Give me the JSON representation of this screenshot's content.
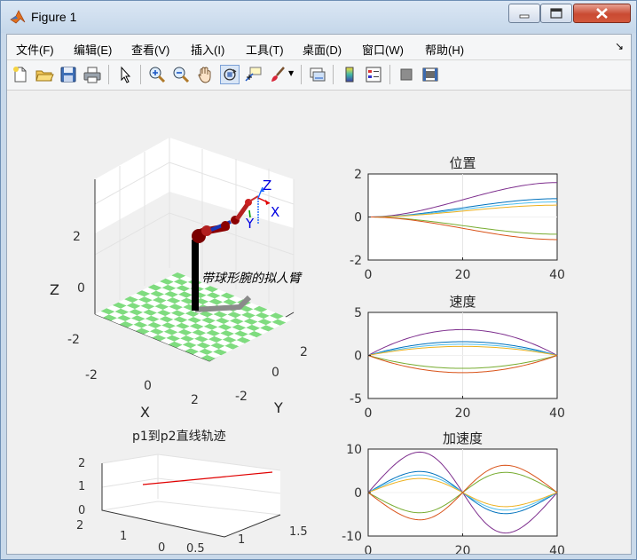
{
  "window": {
    "title": "Figure 1",
    "icon": "matlab-icon"
  },
  "menubar": {
    "items": [
      "文件(F)",
      "编辑(E)",
      "查看(V)",
      "插入(I)",
      "工具(T)",
      "桌面(D)",
      "窗口(W)",
      "帮助(H)"
    ],
    "overflow_arrow": "↘"
  },
  "toolbar": {
    "icons": [
      "new-figure-icon",
      "open-file-icon",
      "save-icon",
      "print-icon",
      "select-pointer-icon",
      "zoom-in-icon",
      "zoom-out-icon",
      "pan-hand-icon",
      "rotate-3d-icon",
      "data-cursor-icon",
      "brush-icon",
      "link-plot-icon",
      "colorbar-icon",
      "legend-icon",
      "hide-plot-tools-icon",
      "show-plot-tools-icon"
    ]
  },
  "robot_plot": {
    "title": "带球形腕的拟人臂",
    "axes": {
      "x_label": "X",
      "y_label": "Y",
      "z_label": "Z"
    },
    "z_ticks": [
      "2",
      "0",
      "-2"
    ],
    "x_ticks": [
      "-2",
      "0",
      "2"
    ],
    "y_ticks": [
      "2",
      "0",
      "-2"
    ],
    "frame_labels": {
      "x": "X",
      "y": "Y",
      "z": "Z"
    },
    "colors": {
      "floor_a": "#7fdc7f",
      "floor_b": "#ffffff",
      "link": "#8b0000",
      "base": "#000000"
    }
  },
  "trajectory_plot": {
    "title": "p1到p2直线轨迹",
    "z_ticks": [
      "2",
      "1",
      "0"
    ],
    "y_ticks": [
      "2",
      "1",
      "0"
    ],
    "x_ticks": [
      "0.5",
      "1",
      "1.5"
    ],
    "line_color": "#e00000"
  },
  "chart_data": [
    {
      "type": "line",
      "title": "位置",
      "xlim": [
        0,
        40
      ],
      "ylim": [
        -2,
        2
      ],
      "x_ticks": [
        "0",
        "20",
        "40"
      ],
      "y_ticks": [
        "2",
        "0",
        "-2"
      ],
      "grid": "x",
      "profile": "position",
      "series": [
        {
          "color": "#7e2f8e",
          "final": 1.6
        },
        {
          "color": "#0072bd",
          "final": 0.85
        },
        {
          "color": "#4dbeee",
          "final": 0.7
        },
        {
          "color": "#edb120",
          "final": 0.55
        },
        {
          "color": "#77ac30",
          "final": -0.8
        },
        {
          "color": "#d95319",
          "final": -1.05
        }
      ]
    },
    {
      "type": "line",
      "title": "速度",
      "xlim": [
        0,
        40
      ],
      "ylim": [
        -5,
        5
      ],
      "x_ticks": [
        "0",
        "20",
        "40"
      ],
      "y_ticks": [
        "5",
        "0",
        "-5"
      ],
      "grid": "x",
      "profile": "velocity",
      "series": [
        {
          "color": "#7e2f8e",
          "peak": 3.0
        },
        {
          "color": "#0072bd",
          "peak": 1.6
        },
        {
          "color": "#4dbeee",
          "peak": 1.3
        },
        {
          "color": "#edb120",
          "peak": 1.05
        },
        {
          "color": "#77ac30",
          "peak": -1.5
        },
        {
          "color": "#d95319",
          "peak": -2.0
        }
      ]
    },
    {
      "type": "line",
      "title": "加速度",
      "xlim": [
        0,
        40
      ],
      "ylim": [
        -10,
        10
      ],
      "x_ticks": [
        "0",
        "20",
        "40"
      ],
      "y_ticks": [
        "10",
        "0",
        "-10"
      ],
      "grid": "x",
      "profile": "acceleration",
      "series": [
        {
          "color": "#7e2f8e",
          "peak": 9.2
        },
        {
          "color": "#0072bd",
          "peak": 4.8
        },
        {
          "color": "#4dbeee",
          "peak": 4.0
        },
        {
          "color": "#edb120",
          "peak": 3.2
        },
        {
          "color": "#77ac30",
          "peak": -4.6
        },
        {
          "color": "#d95319",
          "peak": -6.2
        }
      ]
    }
  ]
}
